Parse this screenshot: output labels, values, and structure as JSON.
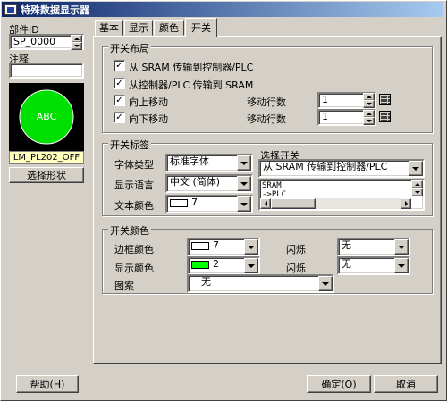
{
  "window": {
    "title": "特殊数据显示器"
  },
  "left": {
    "part_id_label": "部件ID",
    "part_id_value": "SP_0000",
    "comment_label": "注释",
    "comment_value": "",
    "preview_text": "ABC",
    "preview_name": "LM_PL202_OFF",
    "select_shape_label": "选择形状"
  },
  "tabs": [
    "基本",
    "显示",
    "颜色",
    "开关"
  ],
  "switch_layout": {
    "title": "开关布局",
    "items": [
      {
        "label": "从 SRAM 传输到控制器/PLC",
        "checked": true
      },
      {
        "label": "从控制器/PLC 传输到 SRAM",
        "checked": true
      },
      {
        "label": "向上移动",
        "checked": true
      },
      {
        "label": "向下移动",
        "checked": true
      }
    ],
    "move_rows_label": "移动行数",
    "move_up_rows": "1",
    "move_down_rows": "1",
    "check_mark": "✓"
  },
  "switch_label": {
    "title": "开关标签",
    "font_type_label": "字体类型",
    "font_type_value": "标准字体",
    "language_label": "显示语言",
    "language_value": "中文 (简体)",
    "text_color_label": "文本颜色",
    "text_color_value": "7",
    "select_switch_label": "选择开关",
    "select_switch_value": "从 SRAM 传输到控制器/PLC",
    "preview_lines": [
      "SRAM",
      "->PLC"
    ]
  },
  "switch_color": {
    "title": "开关颜色",
    "border_color_label": "边框颜色",
    "border_color_value": "7",
    "display_color_label": "显示颜色",
    "display_color_value": "2",
    "blink_label": "闪烁",
    "blink1_value": "无",
    "blink2_value": "无",
    "pattern_label": "图案",
    "pattern_value": "无"
  },
  "buttons": {
    "help": "帮助(H)",
    "ok": "确定(O)",
    "cancel": "取消"
  },
  "colors": {
    "preview_green": "#00e000",
    "display_green": "#00ff00",
    "label_bg": "#ffffc0"
  }
}
